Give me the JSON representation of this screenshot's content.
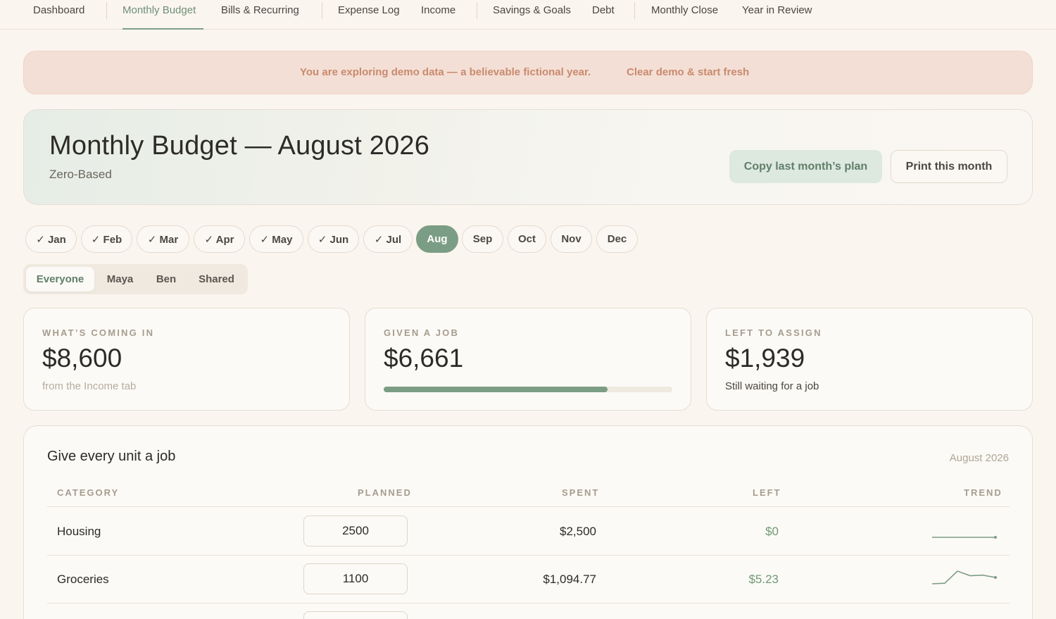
{
  "nav": {
    "items": [
      {
        "label": "Dashboard",
        "active": false
      },
      {
        "label": "Monthly Budget",
        "active": true
      },
      {
        "label": "Bills & Recurring",
        "active": false
      },
      {
        "label": "Expense Log",
        "active": false
      },
      {
        "label": "Income",
        "active": false
      },
      {
        "label": "Savings & Goals",
        "active": false
      },
      {
        "label": "Debt",
        "active": false
      },
      {
        "label": "Monthly Close",
        "active": false
      },
      {
        "label": "Year in Review",
        "active": false
      }
    ]
  },
  "banner": {
    "message": "You are exploring demo data — a believable fictional year.",
    "action": "Clear demo & start fresh"
  },
  "hero": {
    "title": "Monthly Budget — August 2026",
    "subtitle": "Zero-Based",
    "copy_button": "Copy last month’s plan",
    "print_button": "Print this month"
  },
  "months": [
    {
      "label": "✓ Jan",
      "state": "done"
    },
    {
      "label": "✓ Feb",
      "state": "done"
    },
    {
      "label": "✓ Mar",
      "state": "done"
    },
    {
      "label": "✓ Apr",
      "state": "done"
    },
    {
      "label": "✓ May",
      "state": "done"
    },
    {
      "label": "✓ Jun",
      "state": "done"
    },
    {
      "label": "✓ Jul",
      "state": "done"
    },
    {
      "label": "Aug",
      "state": "active"
    },
    {
      "label": "Sep",
      "state": "future"
    },
    {
      "label": "Oct",
      "state": "future"
    },
    {
      "label": "Nov",
      "state": "future"
    },
    {
      "label": "Dec",
      "state": "future"
    }
  ],
  "people": {
    "items": [
      "Everyone",
      "Maya",
      "Ben",
      "Shared"
    ],
    "selected": "Everyone"
  },
  "stats": {
    "coming_in": {
      "label": "WHAT’S COMING IN",
      "value": "$8,600",
      "note": "from the Income tab"
    },
    "given": {
      "label": "GIVEN A JOB",
      "value": "$6,661",
      "progress": 0.775
    },
    "left": {
      "label": "LEFT TO ASSIGN",
      "value": "$1,939",
      "note": "Still waiting for a job"
    }
  },
  "table": {
    "title": "Give every unit a job",
    "period": "August 2026",
    "columns": {
      "category": "CATEGORY",
      "planned": "PLANNED",
      "spent": "SPENT",
      "left": "LEFT",
      "trend": "TREND"
    },
    "rows": [
      {
        "category": "Housing",
        "planned": "2500",
        "spent": "$2,500",
        "left": "$0",
        "trend": [
          2500,
          2500,
          2500,
          2500,
          2500,
          2500,
          2500,
          2500
        ]
      },
      {
        "category": "Groceries",
        "planned": "1100",
        "spent": "$1,094.77",
        "left": "$5.23",
        "trend": [
          1040,
          1045,
          1150,
          1110,
          1115,
          1095
        ]
      }
    ]
  },
  "colors": {
    "accent": "#7c9d85",
    "background": "#faf5ee",
    "banner_bg": "#f3dfd5",
    "banner_text": "#c98a6e",
    "positive": "#6f9a78"
  }
}
